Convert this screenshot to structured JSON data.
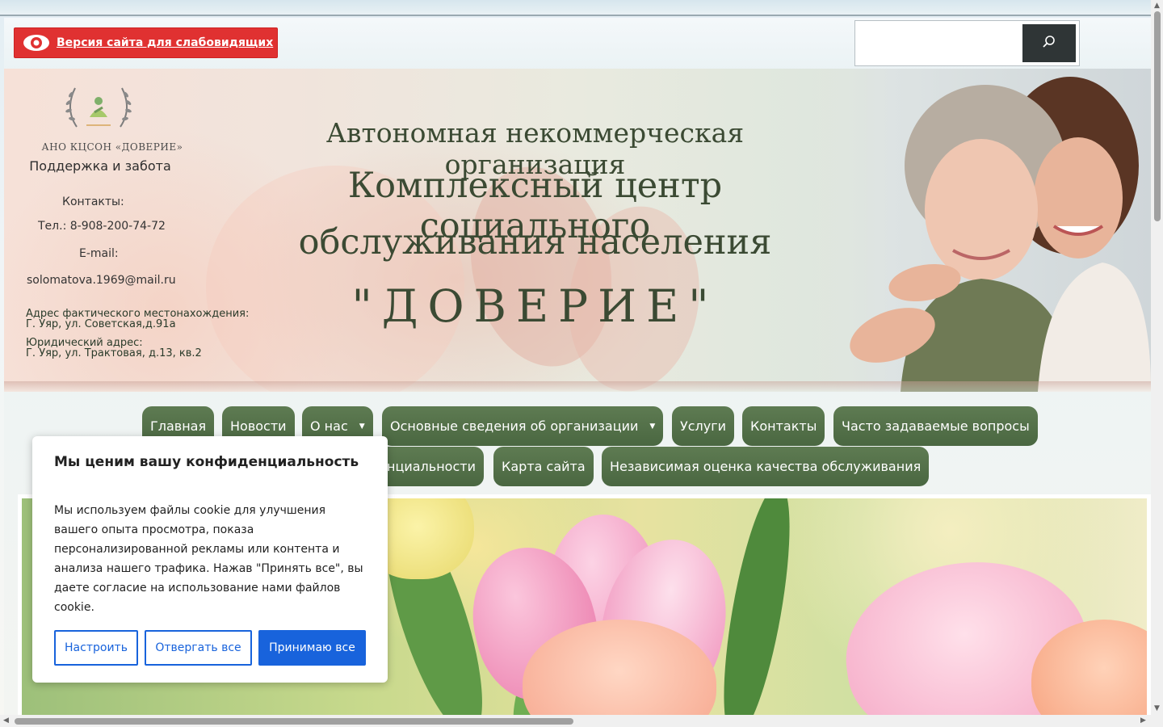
{
  "topbar": {
    "accessibility_label": "Версия сайта для слабовидящих",
    "search_placeholder": ""
  },
  "header": {
    "org_name_small": "АНО КЦСОН «ДОВЕРИЕ»",
    "slogan": "Поддержка и забота",
    "contacts_label": "Контакты:",
    "phone": "Тел.: 8-908-200-74-72",
    "email_label": "E-mail:",
    "email": "solomatova.1969@mail.ru",
    "address_actual_label": "Адрес фактического местонахождения:",
    "address_actual": "Г. Уяр, ул. Советская,д.91а",
    "address_legal_label": "Юридический адрес:",
    "address_legal": "Г. Уяр, ул. Трактовая, д.13, кв.2",
    "title_line1": "Автономная некоммерческая организация",
    "title_line2": "Комплексный центр социального",
    "title_line3": "обслуживания населения",
    "title_line4": "\"ДОВЕРИЕ\""
  },
  "nav": {
    "items": [
      {
        "label": "Главная"
      },
      {
        "label": "Новости"
      },
      {
        "label": "О нас"
      },
      {
        "label": "Основные сведения об организации"
      },
      {
        "label": "Услуги"
      },
      {
        "label": "Контакты"
      },
      {
        "label": "Часто задаваемые вопросы"
      },
      {
        "label": "нциальности"
      },
      {
        "label": "Карта сайта"
      },
      {
        "label": "Независимая оценка качества обслуживания"
      }
    ]
  },
  "cookie": {
    "title": "Мы ценим вашу конфиденциальность",
    "text": "Мы используем файлы cookie для улучшения вашего опыта просмотра, показа персонализированной рекламы или контента и анализа нашего трафика. Нажав \"Принять все\", вы даете согласие на использование нами файлов cookie.",
    "customize_label": "Настроить",
    "reject_label": "Отвергать все",
    "accept_label": "Принимаю все"
  },
  "colors": {
    "accent_red": "#e03131",
    "nav_green": "#4a6741",
    "cookie_blue": "#1863dc",
    "title_green": "#3b4a33"
  },
  "icons": {
    "eye": "eye-icon",
    "search": "search-icon",
    "logo": "laurel-logo-icon",
    "dropdown": "caret-down-icon"
  }
}
